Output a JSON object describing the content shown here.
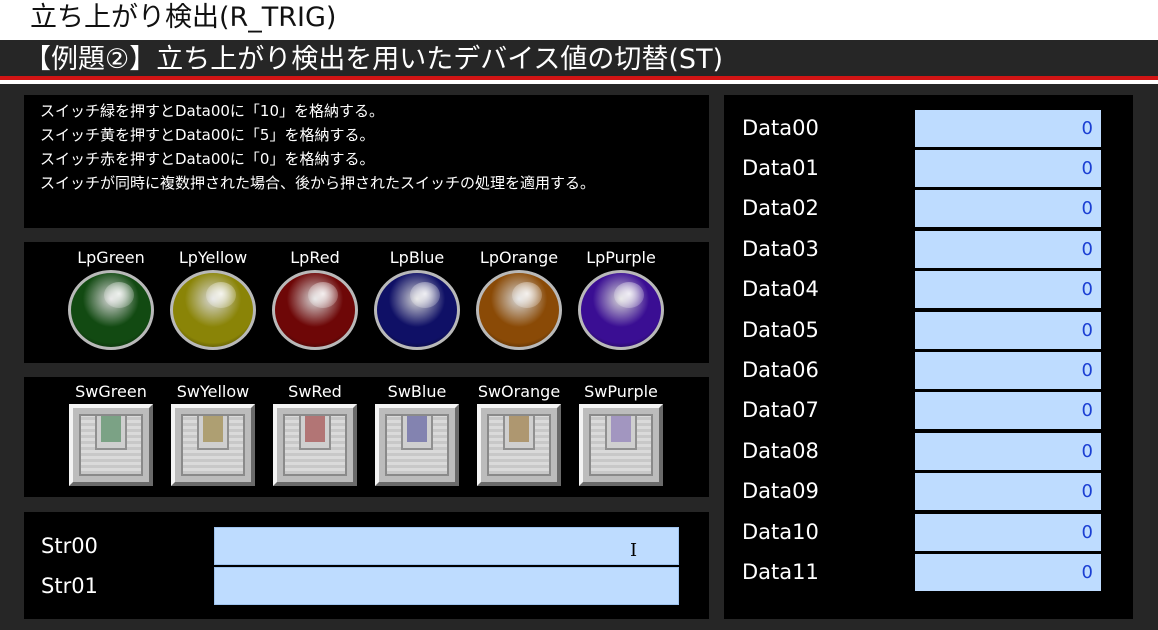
{
  "window": {
    "title": "立ち上がり検出(R_TRIG)"
  },
  "header": {
    "title": "【例題②】立ち上がり検出を用いたデバイス値の切替(ST)"
  },
  "description": {
    "lines": [
      "スイッチ緑を押すとData00に「10」を格納する。",
      "スイッチ黄を押すとData00に「5」を格納する。",
      "スイッチ赤を押すとData00に「0」を格納する。",
      "スイッチが同時に複数押された場合、後から押されたスイッチの処理を適用する。"
    ]
  },
  "lamps": [
    {
      "label": "LpGreen",
      "color": "#124a12",
      "name": "green"
    },
    {
      "label": "LpYellow",
      "color": "#8a8407",
      "name": "yellow"
    },
    {
      "label": "LpRed",
      "color": "#6e0707",
      "name": "red"
    },
    {
      "label": "LpBlue",
      "color": "#0f1066",
      "name": "blue"
    },
    {
      "label": "LpOrange",
      "color": "#8a4a06",
      "name": "orange"
    },
    {
      "label": "LpPurple",
      "color": "#3a0e93",
      "name": "purple"
    }
  ],
  "switches": [
    {
      "label": "SwGreen",
      "color": "#4e8a5e",
      "name": "green"
    },
    {
      "label": "SwYellow",
      "color": "#9d8540",
      "name": "yellow"
    },
    {
      "label": "SwRed",
      "color": "#a34545",
      "name": "red"
    },
    {
      "label": "SwBlue",
      "color": "#5a5aa0",
      "name": "blue"
    },
    {
      "label": "SwOrange",
      "color": "#9d7a3d",
      "name": "orange"
    },
    {
      "label": "SwPurple",
      "color": "#8a78b8",
      "name": "purple"
    }
  ],
  "strings": [
    {
      "label": "Str00",
      "value": ""
    },
    {
      "label": "Str01",
      "value": ""
    }
  ],
  "data": [
    {
      "label": "Data00",
      "value": "0"
    },
    {
      "label": "Data01",
      "value": "0"
    },
    {
      "label": "Data02",
      "value": "0"
    },
    {
      "label": "Data03",
      "value": "0"
    },
    {
      "label": "Data04",
      "value": "0"
    },
    {
      "label": "Data05",
      "value": "0"
    },
    {
      "label": "Data06",
      "value": "0"
    },
    {
      "label": "Data07",
      "value": "0"
    },
    {
      "label": "Data08",
      "value": "0"
    },
    {
      "label": "Data09",
      "value": "0"
    },
    {
      "label": "Data10",
      "value": "0"
    },
    {
      "label": "Data11",
      "value": "0"
    }
  ],
  "cursor": {
    "icon": "text-cursor-icon",
    "glyph": "I"
  },
  "colors": {
    "accent": "#d21414",
    "field_bg": "#bedcff",
    "value_text": "#1b3fd3",
    "panel_bg": "#000000",
    "frame_bg": "#262626"
  }
}
